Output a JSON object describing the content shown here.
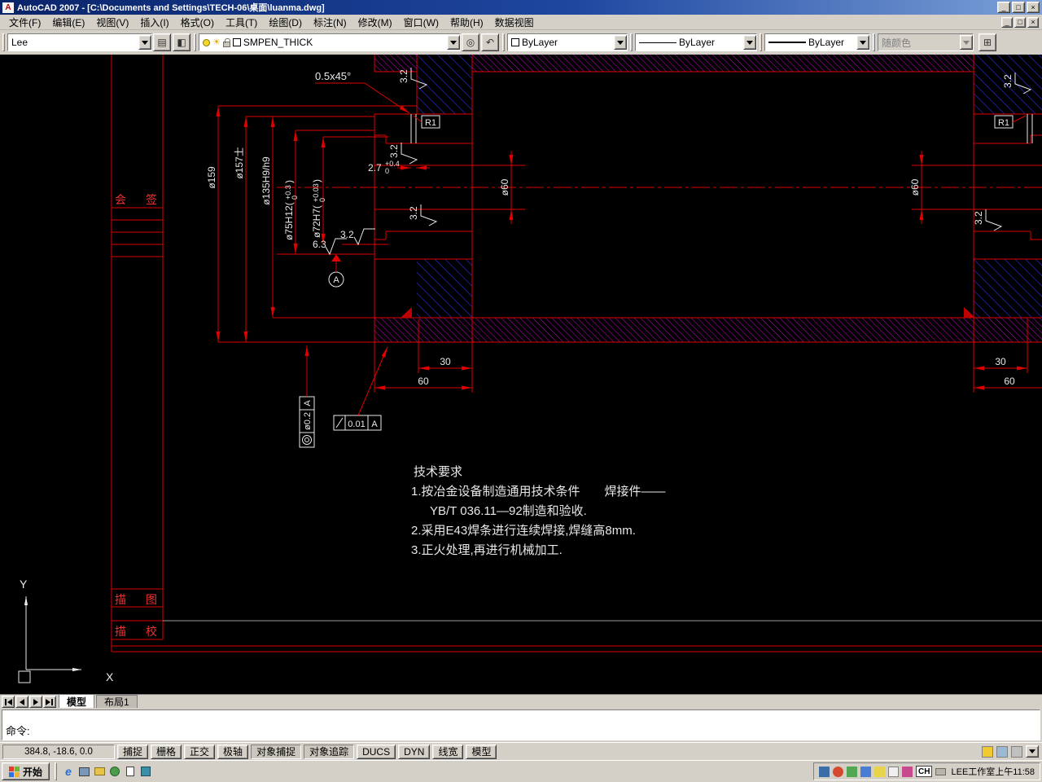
{
  "colors": {
    "background": "#000000",
    "line_red": "#e00000",
    "text_white": "#e8e8e8",
    "hatch_blue": "#2a2ae0",
    "hatch_magenta": "#cc00cc",
    "chrome": "#d4d0c8",
    "titlebar": "#0a246a"
  },
  "icons": {
    "autocad": "A",
    "minimize": "_",
    "maximize": "□",
    "close": "×",
    "layer_manager": "▤",
    "layer_tools": "◧",
    "make_current": "◎",
    "layer_previous": "↶",
    "toolbar_extra": "⊞",
    "sun": "☀"
  },
  "titlebar": {
    "title": "AutoCAD 2007 - [C:\\Documents and Settings\\TECH-06\\桌面\\luanma.dwg]"
  },
  "menubar": {
    "items": [
      "文件(F)",
      "编辑(E)",
      "视图(V)",
      "插入(I)",
      "格式(O)",
      "工具(T)",
      "绘图(D)",
      "标注(N)",
      "修改(M)",
      "窗口(W)",
      "帮助(H)",
      "数据视图"
    ]
  },
  "toolbar": {
    "style": "Lee",
    "layer": "SMPEN_THICK",
    "color": "ByLayer",
    "linetype": "ByLayer",
    "lineweight": "ByLayer",
    "plot_style": "随颜色"
  },
  "drawing": {
    "dims": {
      "chamfer": "0.5x45°",
      "r1": "R1",
      "d159": "ø159",
      "d157": "ø157士",
      "d135": "ø135H9/h9",
      "d75_main": "ø75H12(",
      "d75_sup": "+0.3",
      "d75_sub": "0",
      "d75_close": ")",
      "d72_main": "ø72H7(",
      "d72_sup": "+0.03",
      "d72_sub": "0",
      "d72_close": ")",
      "depth_main": "2.7",
      "depth_sup": "+0.4",
      "depth_sub": "0",
      "d60": "ø60",
      "len30": "30",
      "len60": "60",
      "ra63": "6.3",
      "ra32": "3.2",
      "datum": "A",
      "fcf1_val": "ø0.2",
      "fcf1_datum": "A",
      "fcf2_val": "0.01",
      "fcf2_datum": "A"
    },
    "tech": {
      "title": "技术要求",
      "line1": "1.按冶金设备制造通用技术条件　　焊接件——",
      "line2": "YB/T 036.11—92制造和验收.",
      "line3": "2.采用E43焊条进行连续焊接,焊缝高8mm.",
      "line4": "3.正火处理,再进行机械加工."
    },
    "titleblock": {
      "sign": "会 签",
      "trace": "描 图",
      "check": "描 校"
    },
    "ucs": {
      "x": "X",
      "y": "Y"
    }
  },
  "tabs": {
    "model": "模型",
    "layout": "布局1"
  },
  "command": {
    "prompt": "命令:"
  },
  "statusbar": {
    "coords": "384.8, -18.6, 0.0",
    "buttons": [
      "捕捉",
      "栅格",
      "正交",
      "极轴",
      "对象捕捉",
      "对象追踪",
      "DUCS",
      "DYN",
      "线宽",
      "模型"
    ]
  },
  "taskbar": {
    "start": "开始",
    "ie": "e",
    "input": "CH",
    "clock": "LEE工作室上午11:58"
  }
}
